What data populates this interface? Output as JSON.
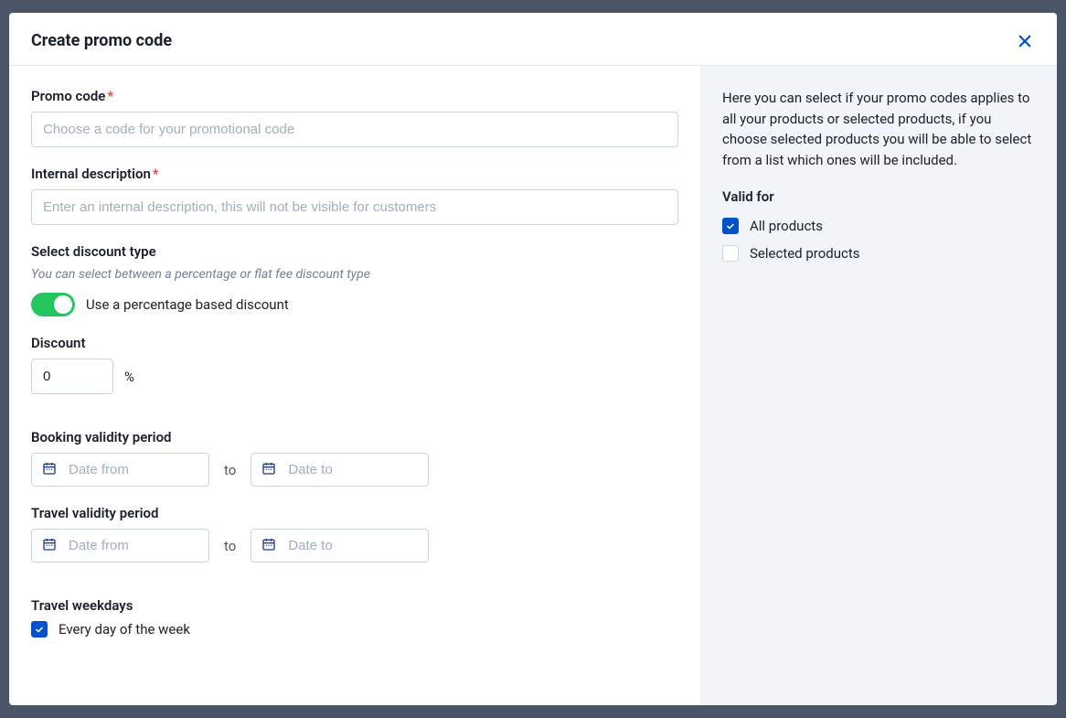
{
  "modal": {
    "title": "Create promo code"
  },
  "form": {
    "promoCode": {
      "label": "Promo code",
      "required": "*",
      "placeholder": "Choose a code for your promotional code",
      "value": ""
    },
    "internalDescription": {
      "label": "Internal description",
      "required": "*",
      "placeholder": "Enter an internal description, this will not be visible for customers",
      "value": ""
    },
    "discountType": {
      "label": "Select discount type",
      "subtext": "You can select between a percentage or flat fee discount type",
      "toggleLabel": "Use a percentage based discount"
    },
    "discount": {
      "label": "Discount",
      "value": "0",
      "unit": "%"
    },
    "bookingValidity": {
      "label": "Booking validity period",
      "fromPlaceholder": "Date from",
      "toPlaceholder": "Date to",
      "separator": "to"
    },
    "travelValidity": {
      "label": "Travel validity period",
      "fromPlaceholder": "Date from",
      "toPlaceholder": "Date to",
      "separator": "to"
    },
    "travelWeekdays": {
      "label": "Travel weekdays",
      "everyDay": "Every day of the week"
    }
  },
  "sidebar": {
    "description": "Here you can select if your promo codes applies to all your products or selected products, if you choose selected products you will be able to select from a list which ones will be included.",
    "validForLabel": "Valid for",
    "allProducts": "All products",
    "selectedProducts": "Selected products"
  }
}
